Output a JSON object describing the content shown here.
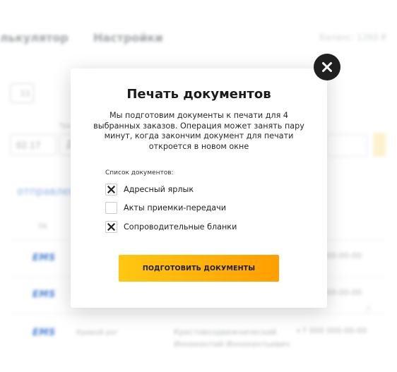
{
  "background": {
    "nav_tabs": [
      "лькулятор",
      "Настройки"
    ],
    "balance": "Баланс: 1260 ₽",
    "chip_text": "11",
    "field_label": "Тра",
    "date_value": "02.17",
    "d_field": "Д",
    "section_title": "отправлен",
    "column_header": "ТК",
    "carrier_logo": "EMS",
    "phones": [
      "00-00-00",
      "00-00-00",
      "+7 000 000-00-00"
    ],
    "city": "Кривой рог",
    "address_line1": "Крестовоздвижнический",
    "address_line2": "Иннокентий Иннокентьевич"
  },
  "modal": {
    "title": "Печать документов",
    "description": "Мы подготовим документы к печати для 4 выбранных заказов. Операция может занять пару минут, когда закончим документ для печати откроется в новом окне",
    "list_label": "Список документов:",
    "documents": [
      {
        "label": "Адресный ярлык",
        "checked": true
      },
      {
        "label": "Акты приемки-передачи",
        "checked": false
      },
      {
        "label": "Сопроводительные бланки",
        "checked": true
      }
    ],
    "prepare_button": "ПОДГОТОВИТЬ ДОКУМЕНТЫ",
    "close_icon": "close-icon"
  },
  "colors": {
    "accent": "#ffb10a",
    "close_bg": "#202020",
    "ems_blue": "#1f66c9",
    "link_blue": "#7fa6d9"
  }
}
